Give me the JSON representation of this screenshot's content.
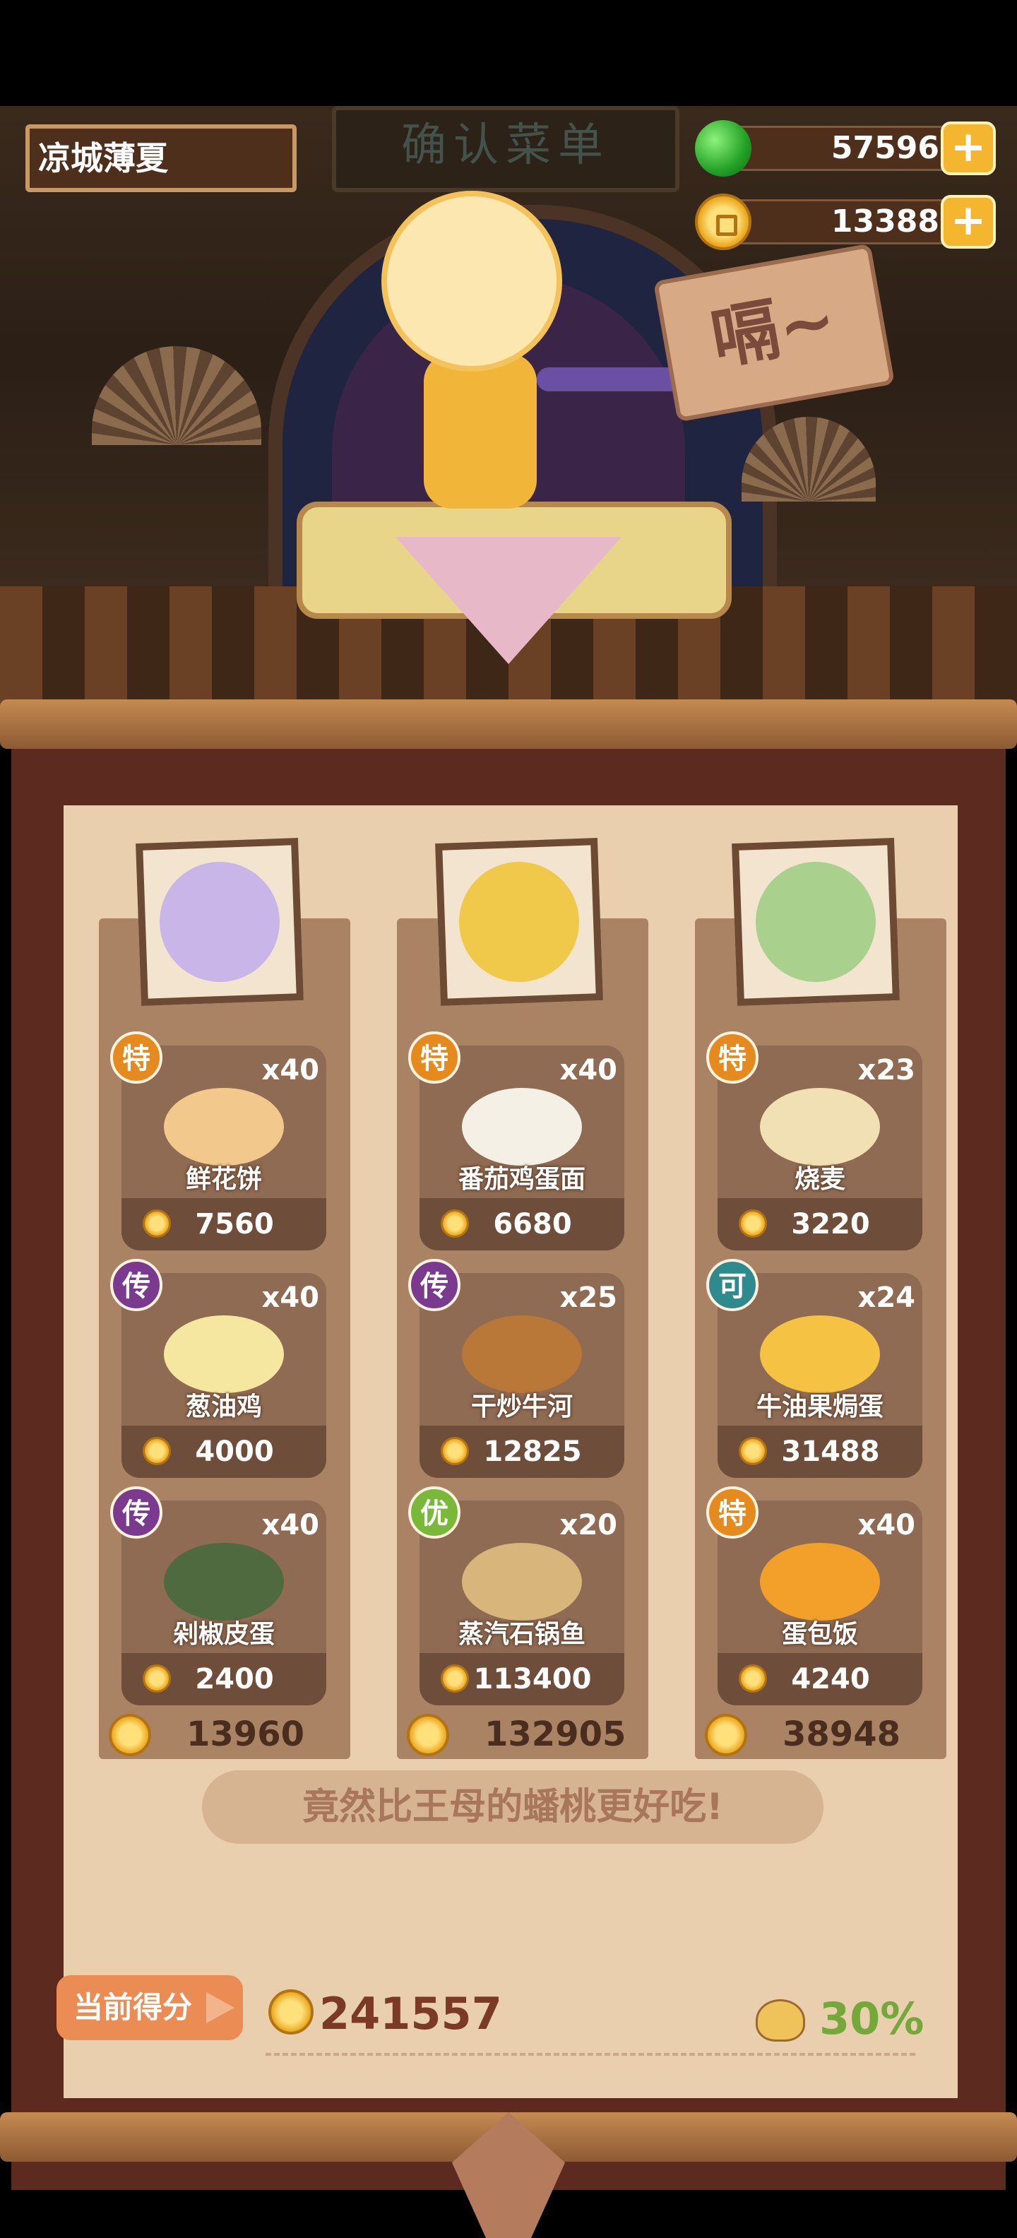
{
  "header": {
    "player_name": "凉城薄夏",
    "sign_text": "确认菜单",
    "speech_tag": "嗝~",
    "currencies": [
      {
        "icon": "jade-icon",
        "value": "57596"
      },
      {
        "icon": "coin-icon",
        "value": "13388"
      }
    ],
    "plus_label": "+"
  },
  "columns": [
    {
      "portrait": "purple-haired-girl-portrait",
      "dishes": [
        {
          "badge": "特",
          "count": "x40",
          "name": "鲜花饼",
          "price": "7560"
        },
        {
          "badge": "传",
          "count": "x40",
          "name": "葱油鸡",
          "price": "4000"
        },
        {
          "badge": "传",
          "count": "x40",
          "name": "剁椒皮蛋",
          "price": "2400"
        }
      ],
      "total": "13960"
    },
    {
      "portrait": "lion-dancer-portrait",
      "dishes": [
        {
          "badge": "特",
          "count": "x40",
          "name": "番茄鸡蛋面",
          "price": "6680"
        },
        {
          "badge": "传",
          "count": "x25",
          "name": "干炒牛河",
          "price": "12825"
        },
        {
          "badge": "优",
          "count": "x20",
          "name": "蒸汽石锅鱼",
          "price": "113400"
        }
      ],
      "total": "132905"
    },
    {
      "portrait": "green-hooded-girl-portrait",
      "dishes": [
        {
          "badge": "特",
          "count": "x23",
          "name": "烧麦",
          "price": "3220"
        },
        {
          "badge": "可",
          "count": "x24",
          "name": "牛油果焗蛋",
          "price": "31488"
        },
        {
          "badge": "特",
          "count": "x40",
          "name": "蛋包饭",
          "price": "4240"
        }
      ],
      "total": "38948"
    }
  ],
  "comment": "竟然比王母的蟠桃更好吃!",
  "score": {
    "button_label": "当前得分",
    "value": "241557",
    "bonus_percent": "30%"
  },
  "colors": {
    "badge_te": "#e48a1f",
    "badge_chuan": "#7a3a8e",
    "badge_ke": "#2f8a8e",
    "badge_you": "#7ab83a",
    "percent": "#74a83a",
    "score": "#7a3a26"
  }
}
